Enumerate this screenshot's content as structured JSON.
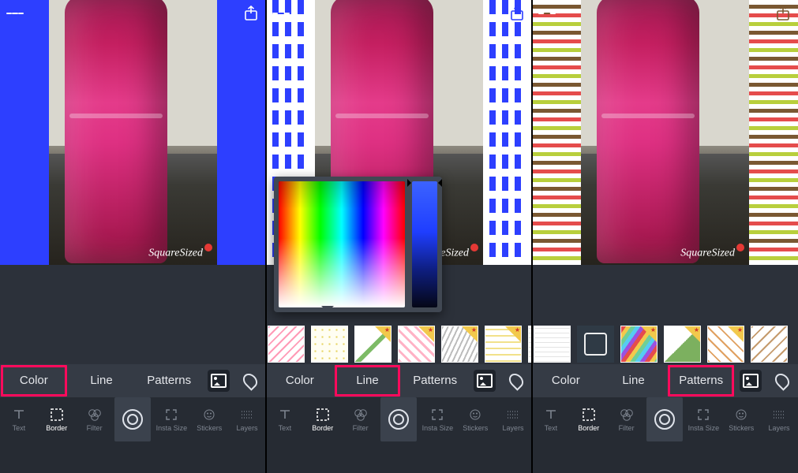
{
  "watermark": "SquareSized",
  "tabs": {
    "color": "Color",
    "line": "Line",
    "patterns": "Patterns"
  },
  "panels": [
    {
      "selected_tab": "color"
    },
    {
      "selected_tab": "line"
    },
    {
      "selected_tab": "patterns"
    }
  ],
  "tools": {
    "text": "Text",
    "border": "Border",
    "filter": "Filter",
    "insta": "Insta Size",
    "stickers": "Stickers",
    "layers": "Layers"
  },
  "pattern_thumbs": [
    "wave-pink",
    "dots-yel",
    "diag",
    "chev-pink",
    "chev-grey",
    "wave-yel",
    "lines",
    "dark",
    "rainbow",
    "greentri",
    "diagthin",
    "diagthin2"
  ],
  "premium_indices": [
    2,
    3,
    4,
    5,
    8,
    9,
    10
  ],
  "picker": {
    "hue_hint": "blue"
  }
}
